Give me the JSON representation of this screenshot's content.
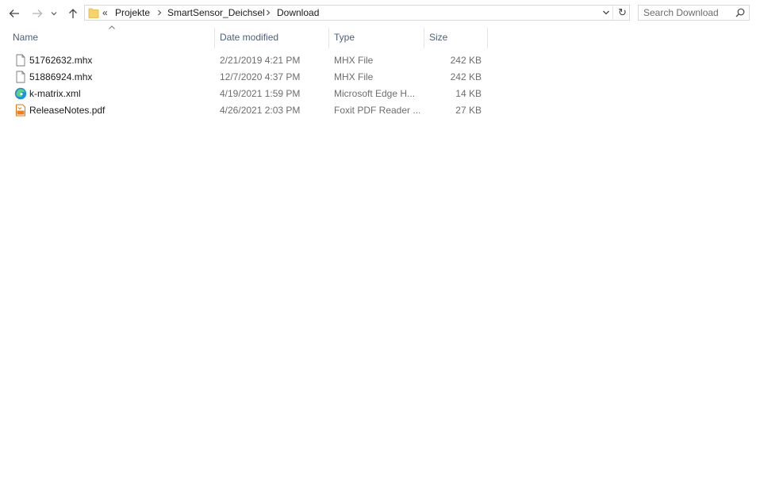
{
  "address": {
    "overflow": "«",
    "crumbs": [
      "Projekte",
      "SmartSensor_Deichsel",
      "Download"
    ]
  },
  "search": {
    "placeholder": "Search Download"
  },
  "columns": {
    "name": "Name",
    "date": "Date modified",
    "type": "Type",
    "size": "Size"
  },
  "files": [
    {
      "name": "51762632.mhx",
      "date": "2/21/2019 4:21 PM",
      "type": "MHX File",
      "size": "242 KB",
      "icon": "file-icon"
    },
    {
      "name": "51886924.mhx",
      "date": "12/7/2020 4:37 PM",
      "type": "MHX File",
      "size": "242 KB",
      "icon": "file-icon"
    },
    {
      "name": "k-matrix.xml",
      "date": "4/19/2021 1:59 PM",
      "type": "Microsoft Edge H...",
      "size": "14 KB",
      "icon": "edge-icon"
    },
    {
      "name": "ReleaseNotes.pdf",
      "date": "4/26/2021 2:03 PM",
      "type": "Foxit PDF Reader ...",
      "size": "27 KB",
      "icon": "pdf-icon"
    }
  ]
}
